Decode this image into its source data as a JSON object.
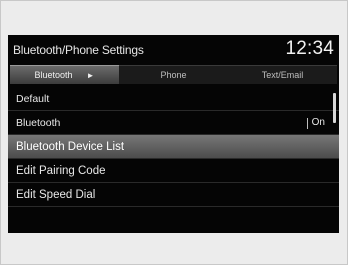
{
  "header": {
    "title": "Bluetooth/Phone Settings",
    "clock": "12:34"
  },
  "tabs": [
    {
      "label": "Bluetooth",
      "active": true,
      "arrow": "►"
    },
    {
      "label": "Phone",
      "active": false
    },
    {
      "label": "Text/Email",
      "active": false
    }
  ],
  "menu": {
    "items": [
      {
        "label": "Default"
      },
      {
        "label": "Bluetooth",
        "value": "On"
      },
      {
        "label": "Bluetooth Device List",
        "selected": true
      },
      {
        "label": "Edit Pairing Code"
      },
      {
        "label": "Edit Speed Dial"
      }
    ]
  },
  "colors": {
    "screen_background": "#050505",
    "highlight": "#6a6a6a",
    "text": "#e8e8e8"
  }
}
